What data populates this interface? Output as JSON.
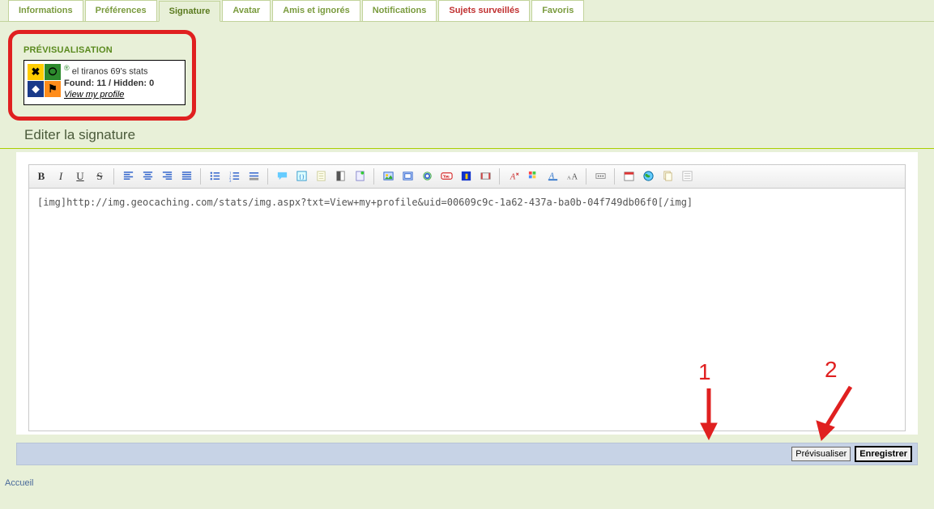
{
  "tabs": {
    "items": [
      {
        "label": "Informations",
        "active": false,
        "red": false
      },
      {
        "label": "Préférences",
        "active": false,
        "red": false
      },
      {
        "label": "Signature",
        "active": true,
        "red": false
      },
      {
        "label": "Avatar",
        "active": false,
        "red": false
      },
      {
        "label": "Amis et ignorés",
        "active": false,
        "red": false
      },
      {
        "label": "Notifications",
        "active": false,
        "red": false
      },
      {
        "label": "Sujets surveillés",
        "active": false,
        "red": true
      },
      {
        "label": "Favoris",
        "active": false,
        "red": false
      }
    ]
  },
  "preview": {
    "heading": "PRÉVISUALISATION",
    "card": {
      "line1": "el tiranos 69's stats",
      "line2": "Found: 11 / Hidden: 0",
      "line3": "View my profile",
      "reg_mark": "®"
    }
  },
  "section": {
    "title": "Editer la signature"
  },
  "editor": {
    "content": "[img]http://img.geocaching.com/stats/img.aspx?txt=View+my+profile&uid=00609c9c-1a62-437a-ba0b-04f749db06f0[/img]"
  },
  "toolbar": {
    "bold": "B",
    "italic": "I",
    "underline": "U",
    "strike": "S"
  },
  "footer_buttons": {
    "preview": "Prévisualiser",
    "save": "Enregistrer"
  },
  "breadcrumb": {
    "home": "Accueil"
  },
  "annotations": {
    "n1": "1",
    "n2": "2"
  }
}
